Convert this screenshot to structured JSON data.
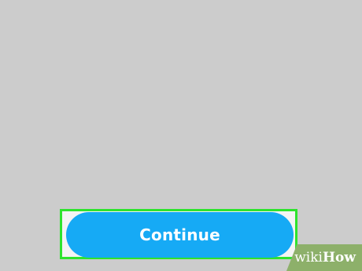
{
  "screen": {
    "background_color": "#cccccc"
  },
  "continue_button": {
    "label": "Continue",
    "color": "#16aaf5",
    "text_color": "#ffffff"
  },
  "highlight": {
    "color": "#2ee32e"
  },
  "watermark": {
    "part1": "wiki",
    "part2": "How",
    "background_color": "#8db06a"
  }
}
